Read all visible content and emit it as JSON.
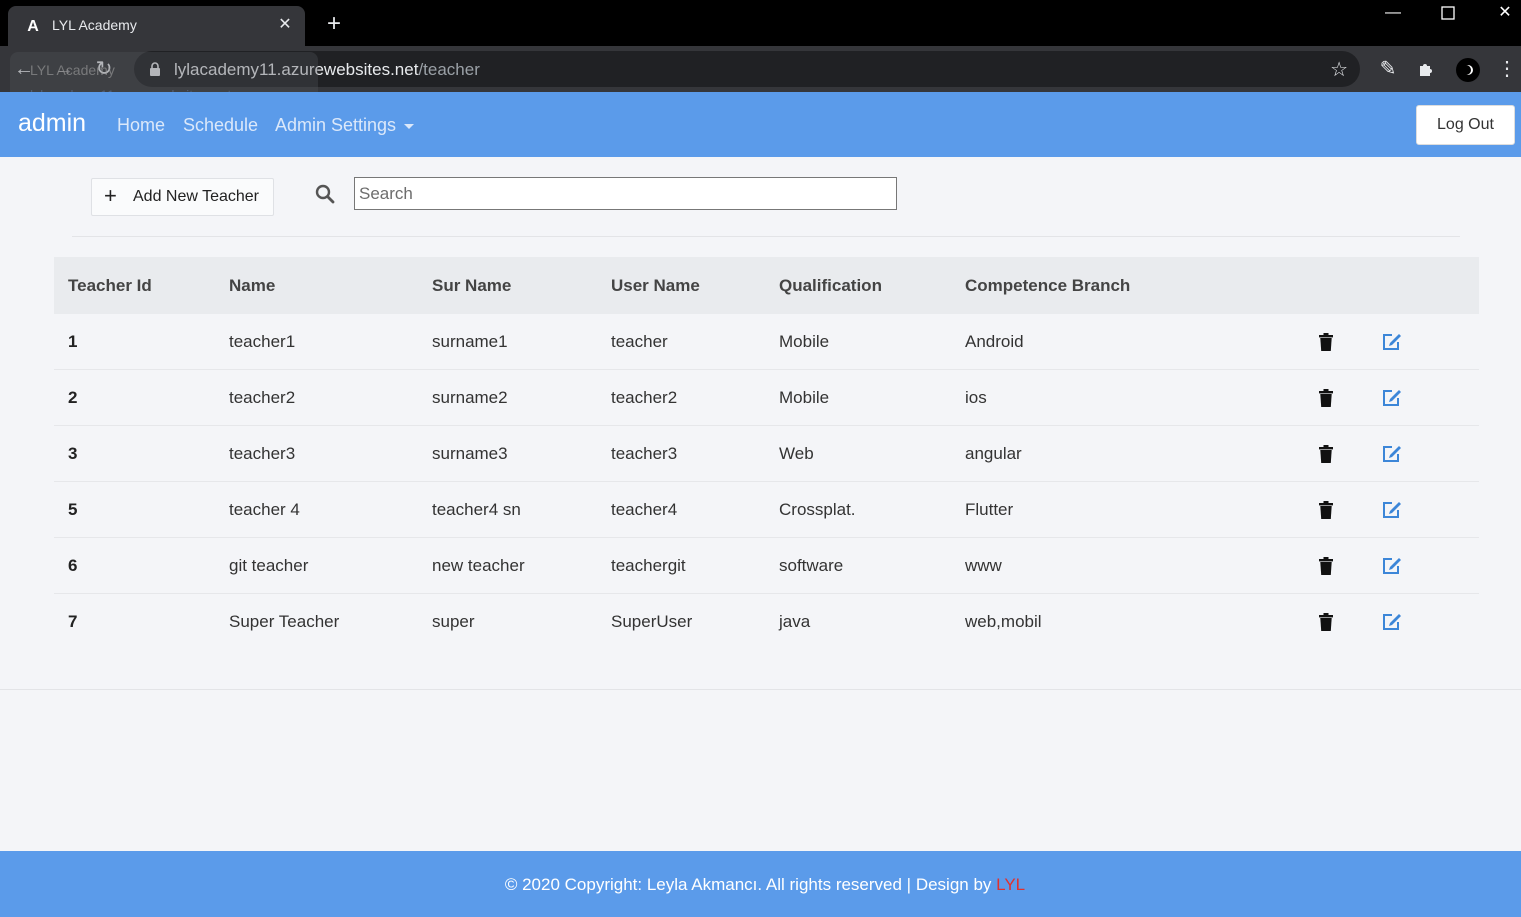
{
  "browser": {
    "tab_title": "LYL Academy",
    "url_domain": "lylacademy11.azurewebsites.net",
    "url_path": "/teacher",
    "hover_title": "LYL Academy",
    "hover_url": "lylacademy11.azurewebsites.net"
  },
  "navbar": {
    "brand": "admin",
    "links": [
      "Home",
      "Schedule",
      "Admin Settings"
    ],
    "logout_label": "Log Out",
    "color": "#5b9bea"
  },
  "toolbar": {
    "add_label": "Add New Teacher",
    "search_placeholder": "Search"
  },
  "table": {
    "headers": [
      "Teacher Id",
      "Name",
      "Sur Name",
      "User Name",
      "Qualification",
      "Competence Branch"
    ],
    "rows": [
      {
        "id": "1",
        "name": "teacher1",
        "surname": "surname1",
        "username": "teacher",
        "qualification": "Mobile",
        "branch": "Android"
      },
      {
        "id": "2",
        "name": "teacher2",
        "surname": "surname2",
        "username": "teacher2",
        "qualification": "Mobile",
        "branch": "ios"
      },
      {
        "id": "3",
        "name": "teacher3",
        "surname": "surname3",
        "username": "teacher3",
        "qualification": "Web",
        "branch": "angular"
      },
      {
        "id": "5",
        "name": "teacher 4",
        "surname": "teacher4 sn",
        "username": "teacher4",
        "qualification": "Crossplat.",
        "branch": "Flutter"
      },
      {
        "id": "6",
        "name": "git teacher",
        "surname": "new teacher",
        "username": "teachergit",
        "qualification": "software",
        "branch": "www"
      },
      {
        "id": "7",
        "name": "Super Teacher",
        "surname": "super",
        "username": "SuperUser",
        "qualification": "java",
        "branch": "web,mobil"
      }
    ],
    "icons": {
      "delete": "trash-icon",
      "edit": "edit-icon"
    },
    "edit_color": "#3c86d8"
  },
  "footer": {
    "text": "© 2020 Copyright: Leyla Akmancı. All rights reserved | Design by ",
    "brand": "LYL",
    "brand_color": "#e0312f"
  }
}
